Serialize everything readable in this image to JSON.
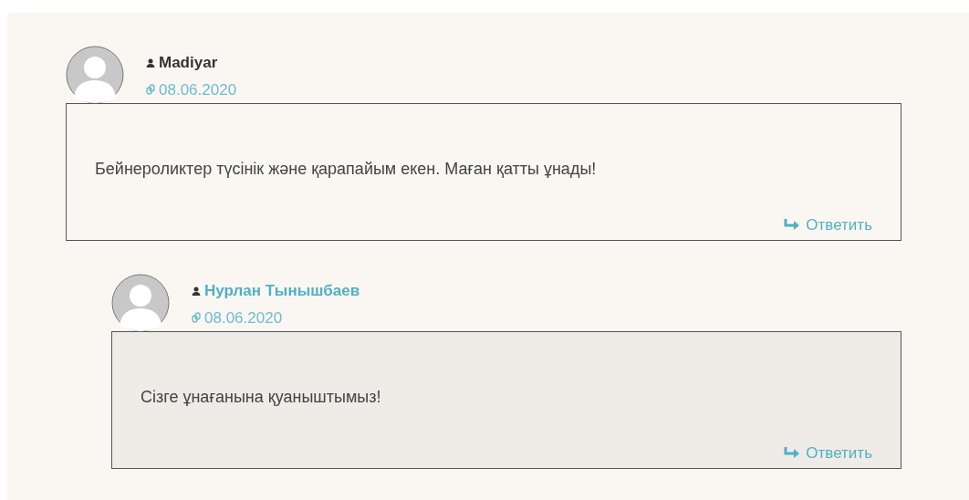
{
  "comments": [
    {
      "author": "Madiyar",
      "author_linked": false,
      "date": "08.06.2020",
      "text": "Бейнероликтер түсінік және қарапайым екен. Маған қатты ұнады!",
      "reply_label": "Ответить",
      "children": [
        {
          "author": "Нурлан Тынышбаев",
          "author_linked": true,
          "date": "08.06.2020",
          "text": "Сізге ұнағанына қуаныштымыз!",
          "reply_label": "Ответить"
        }
      ]
    }
  ]
}
